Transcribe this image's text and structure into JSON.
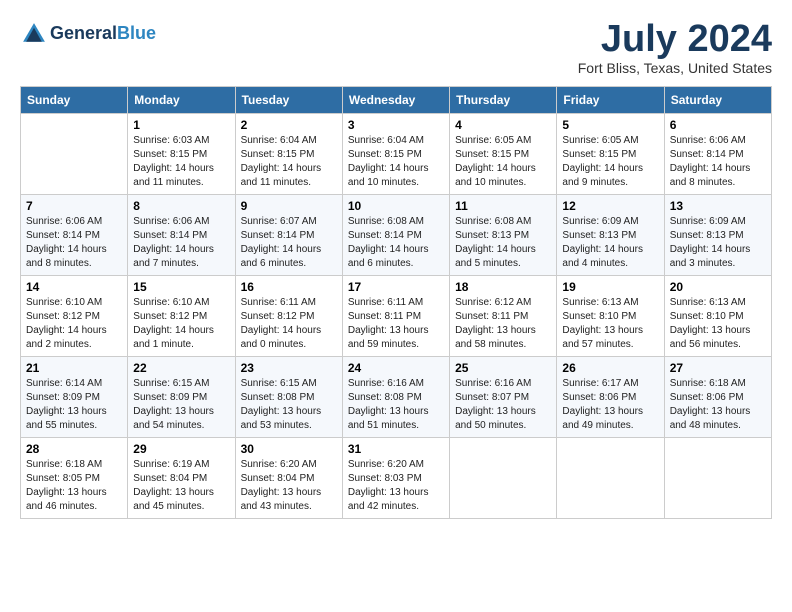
{
  "header": {
    "logo_line1": "General",
    "logo_line2": "Blue",
    "month_title": "July 2024",
    "location": "Fort Bliss, Texas, United States"
  },
  "weekdays": [
    "Sunday",
    "Monday",
    "Tuesday",
    "Wednesday",
    "Thursday",
    "Friday",
    "Saturday"
  ],
  "weeks": [
    [
      {
        "num": "",
        "info": ""
      },
      {
        "num": "1",
        "info": "Sunrise: 6:03 AM\nSunset: 8:15 PM\nDaylight: 14 hours\nand 11 minutes."
      },
      {
        "num": "2",
        "info": "Sunrise: 6:04 AM\nSunset: 8:15 PM\nDaylight: 14 hours\nand 11 minutes."
      },
      {
        "num": "3",
        "info": "Sunrise: 6:04 AM\nSunset: 8:15 PM\nDaylight: 14 hours\nand 10 minutes."
      },
      {
        "num": "4",
        "info": "Sunrise: 6:05 AM\nSunset: 8:15 PM\nDaylight: 14 hours\nand 10 minutes."
      },
      {
        "num": "5",
        "info": "Sunrise: 6:05 AM\nSunset: 8:15 PM\nDaylight: 14 hours\nand 9 minutes."
      },
      {
        "num": "6",
        "info": "Sunrise: 6:06 AM\nSunset: 8:14 PM\nDaylight: 14 hours\nand 8 minutes."
      }
    ],
    [
      {
        "num": "7",
        "info": "Sunrise: 6:06 AM\nSunset: 8:14 PM\nDaylight: 14 hours\nand 8 minutes."
      },
      {
        "num": "8",
        "info": "Sunrise: 6:06 AM\nSunset: 8:14 PM\nDaylight: 14 hours\nand 7 minutes."
      },
      {
        "num": "9",
        "info": "Sunrise: 6:07 AM\nSunset: 8:14 PM\nDaylight: 14 hours\nand 6 minutes."
      },
      {
        "num": "10",
        "info": "Sunrise: 6:08 AM\nSunset: 8:14 PM\nDaylight: 14 hours\nand 6 minutes."
      },
      {
        "num": "11",
        "info": "Sunrise: 6:08 AM\nSunset: 8:13 PM\nDaylight: 14 hours\nand 5 minutes."
      },
      {
        "num": "12",
        "info": "Sunrise: 6:09 AM\nSunset: 8:13 PM\nDaylight: 14 hours\nand 4 minutes."
      },
      {
        "num": "13",
        "info": "Sunrise: 6:09 AM\nSunset: 8:13 PM\nDaylight: 14 hours\nand 3 minutes."
      }
    ],
    [
      {
        "num": "14",
        "info": "Sunrise: 6:10 AM\nSunset: 8:12 PM\nDaylight: 14 hours\nand 2 minutes."
      },
      {
        "num": "15",
        "info": "Sunrise: 6:10 AM\nSunset: 8:12 PM\nDaylight: 14 hours\nand 1 minute."
      },
      {
        "num": "16",
        "info": "Sunrise: 6:11 AM\nSunset: 8:12 PM\nDaylight: 14 hours\nand 0 minutes."
      },
      {
        "num": "17",
        "info": "Sunrise: 6:11 AM\nSunset: 8:11 PM\nDaylight: 13 hours\nand 59 minutes."
      },
      {
        "num": "18",
        "info": "Sunrise: 6:12 AM\nSunset: 8:11 PM\nDaylight: 13 hours\nand 58 minutes."
      },
      {
        "num": "19",
        "info": "Sunrise: 6:13 AM\nSunset: 8:10 PM\nDaylight: 13 hours\nand 57 minutes."
      },
      {
        "num": "20",
        "info": "Sunrise: 6:13 AM\nSunset: 8:10 PM\nDaylight: 13 hours\nand 56 minutes."
      }
    ],
    [
      {
        "num": "21",
        "info": "Sunrise: 6:14 AM\nSunset: 8:09 PM\nDaylight: 13 hours\nand 55 minutes."
      },
      {
        "num": "22",
        "info": "Sunrise: 6:15 AM\nSunset: 8:09 PM\nDaylight: 13 hours\nand 54 minutes."
      },
      {
        "num": "23",
        "info": "Sunrise: 6:15 AM\nSunset: 8:08 PM\nDaylight: 13 hours\nand 53 minutes."
      },
      {
        "num": "24",
        "info": "Sunrise: 6:16 AM\nSunset: 8:08 PM\nDaylight: 13 hours\nand 51 minutes."
      },
      {
        "num": "25",
        "info": "Sunrise: 6:16 AM\nSunset: 8:07 PM\nDaylight: 13 hours\nand 50 minutes."
      },
      {
        "num": "26",
        "info": "Sunrise: 6:17 AM\nSunset: 8:06 PM\nDaylight: 13 hours\nand 49 minutes."
      },
      {
        "num": "27",
        "info": "Sunrise: 6:18 AM\nSunset: 8:06 PM\nDaylight: 13 hours\nand 48 minutes."
      }
    ],
    [
      {
        "num": "28",
        "info": "Sunrise: 6:18 AM\nSunset: 8:05 PM\nDaylight: 13 hours\nand 46 minutes."
      },
      {
        "num": "29",
        "info": "Sunrise: 6:19 AM\nSunset: 8:04 PM\nDaylight: 13 hours\nand 45 minutes."
      },
      {
        "num": "30",
        "info": "Sunrise: 6:20 AM\nSunset: 8:04 PM\nDaylight: 13 hours\nand 43 minutes."
      },
      {
        "num": "31",
        "info": "Sunrise: 6:20 AM\nSunset: 8:03 PM\nDaylight: 13 hours\nand 42 minutes."
      },
      {
        "num": "",
        "info": ""
      },
      {
        "num": "",
        "info": ""
      },
      {
        "num": "",
        "info": ""
      }
    ]
  ]
}
